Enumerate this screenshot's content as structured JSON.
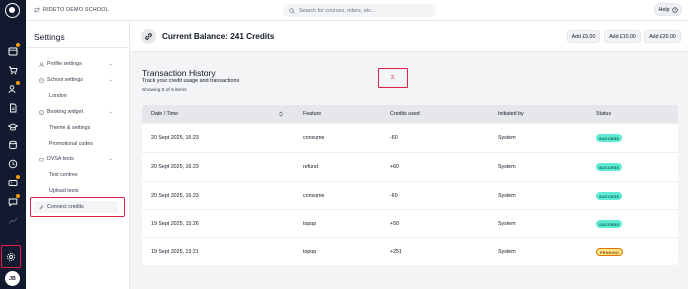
{
  "topbar": {
    "school_name": "RIDETO DEMO SCHOOL",
    "search_placeholder": "Search for courses, riders, etc...",
    "help_label": "Help"
  },
  "rail": {
    "avatar_initials": "JB",
    "icons": [
      "calendar-icon",
      "cart-icon",
      "users-icon",
      "document-icon",
      "graduation-icon",
      "database-icon",
      "clock-icon",
      "ticket-icon",
      "chat-icon",
      "chart-icon",
      "settings-icon"
    ]
  },
  "settings": {
    "title": "Settings",
    "items": [
      {
        "label": "Profile settings",
        "icon": "user-icon"
      },
      {
        "label": "School settings",
        "icon": "school-icon"
      },
      {
        "label": "London"
      },
      {
        "label": "Booking widget",
        "icon": "widget-icon"
      },
      {
        "label": "Theme & settings"
      },
      {
        "label": "Promotional codes"
      },
      {
        "label": "DVSA tests",
        "icon": "dvsa-icon"
      },
      {
        "label": "Test centres"
      },
      {
        "label": "Upload tests"
      },
      {
        "label": "Connect credits",
        "icon": "link-icon"
      }
    ]
  },
  "balance": {
    "title": "Current Balance: 241 Credits",
    "buttons": [
      "Add £5.00",
      "Add £10.00",
      "Add £20.00"
    ]
  },
  "history": {
    "title": "Transaction History",
    "subtitle": "Track your credit usage and transactions",
    "count_text": "Showing 5 of 5 items",
    "marker_label": "3."
  },
  "table": {
    "headers": [
      "Date / Time",
      "Feature",
      "Credits used",
      "Initiated by",
      "Status"
    ],
    "rows": [
      {
        "date": "20 Sept 2025, 16:23",
        "feature": "consume",
        "credits": "-60",
        "initiated": "System",
        "status": "SUCCESS"
      },
      {
        "date": "20 Sept 2025, 16:23",
        "feature": "refund",
        "credits": "+60",
        "initiated": "System",
        "status": "SUCCESS"
      },
      {
        "date": "20 Sept 2025, 16:23",
        "feature": "consume",
        "credits": "-60",
        "initiated": "System",
        "status": "SUCCESS"
      },
      {
        "date": "19 Sept 2025, 15:26",
        "feature": "topup",
        "credits": "+50",
        "initiated": "System",
        "status": "SUCCESS"
      },
      {
        "date": "19 Sept 2025, 13:21",
        "feature": "topup",
        "credits": "+251",
        "initiated": "System",
        "status": "PENDING"
      }
    ]
  },
  "colors": {
    "rail_bg": "#111a2e",
    "highlight_box": "#e11d48",
    "badge_success": "#5eead4",
    "badge_pending": "#fde68a"
  }
}
